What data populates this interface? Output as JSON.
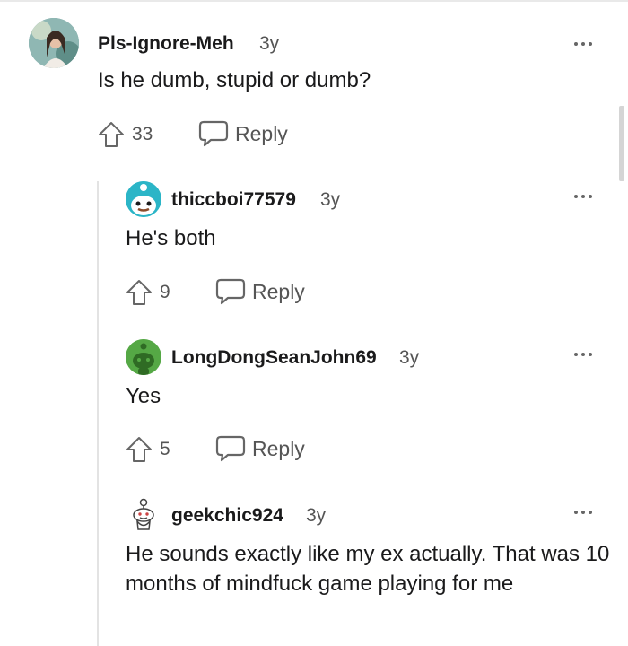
{
  "comments": [
    {
      "username": "Pls-Ignore-Meh",
      "age": "3y",
      "body": "Is he dumb, stupid or dumb?",
      "upvotes": "33",
      "reply_label": "Reply",
      "avatar": "profile-photo"
    },
    {
      "username": "thiccboi77579",
      "age": "3y",
      "body": "He's both",
      "upvotes": "9",
      "reply_label": "Reply",
      "avatar": "snoo-teal"
    },
    {
      "username": "LongDongSeanJohn69",
      "age": "3y",
      "body": "Yes",
      "upvotes": "5",
      "reply_label": "Reply",
      "avatar": "snoo-green"
    },
    {
      "username": "geekchic924",
      "age": "3y",
      "body": "He sounds exactly like my ex actually. That was 10 months of mindfuck game playing for me",
      "avatar": "snoo-outline"
    }
  ],
  "icons": {
    "upvote": "upvote-arrow-icon",
    "reply": "speech-bubble-icon",
    "more": "more-options-icon"
  },
  "colors": {
    "text": "#1a1a1b",
    "meta": "#555555",
    "thread_line": "#e3e3e3",
    "avatar_teal": "#2bb5c7",
    "avatar_green": "#55a845"
  }
}
